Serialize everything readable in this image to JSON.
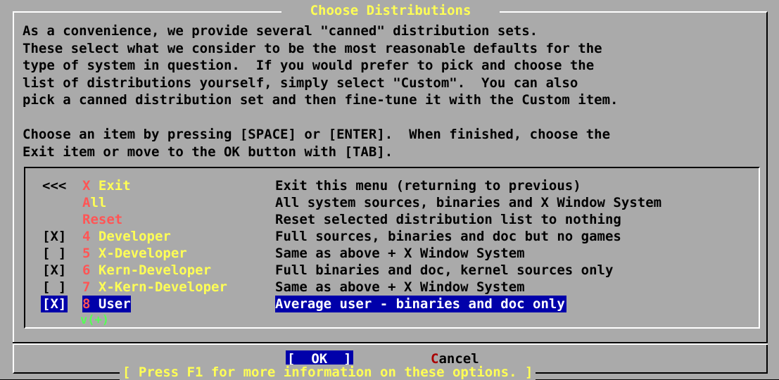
{
  "dialog": {
    "title": "Choose Distributions",
    "intro": [
      "As a convenience, we provide several \"canned\" distribution sets.",
      "These select what we consider to be the most reasonable defaults for the",
      "type of system in question.  If you would prefer to pick and choose the",
      "list of distributions yourself, simply select \"Custom\".  You can also",
      "pick a canned distribution set and then fine-tune it with the Custom item.",
      "",
      "Choose an item by pressing [SPACE] or [ENTER].  When finished, choose the",
      "Exit item or move to the OK button with [TAB]."
    ]
  },
  "menu": {
    "items": [
      {
        "marker": "<<<",
        "hotkey": "X",
        "label": "Exit",
        "description": "Exit this menu (returning to previous)"
      },
      {
        "marker": "",
        "hotkey": "A",
        "label": "ll",
        "description": "All system sources, binaries and X Window System"
      },
      {
        "marker": "",
        "hotkey": "R",
        "label": "eset",
        "description": "Reset selected distribution list to nothing"
      },
      {
        "marker": "[X]",
        "hotkey": "4",
        "label": "Developer",
        "description": "Full sources, binaries and doc but no games"
      },
      {
        "marker": "[ ]",
        "hotkey": "5",
        "label": "X-Developer",
        "description": "Same as above + X Window System"
      },
      {
        "marker": "[X]",
        "hotkey": "6",
        "label": "Kern-Developer",
        "description": "Full binaries and doc, kernel sources only"
      },
      {
        "marker": "[ ]",
        "hotkey": "7",
        "label": "X-Kern-Developer",
        "description": "Same as above + X Window System"
      },
      {
        "marker": "[X]",
        "hotkey": "8",
        "label": "User",
        "description": "Average user - binaries and doc only"
      }
    ],
    "more_indicator": "v(+)"
  },
  "buttons": {
    "ok_pre": "[  ",
    "ok_hotkey": "O",
    "ok_rest": "K  ]",
    "cancel_hotkey": "C",
    "cancel_rest": "ancel"
  },
  "footer": "[ Press F1 for more information on these options. ]",
  "colors": {
    "background": "#aaaaaa",
    "title": "#ffff55",
    "hotkey": "#ff5555",
    "selection": "#0000aa",
    "more": "#55ff55"
  }
}
